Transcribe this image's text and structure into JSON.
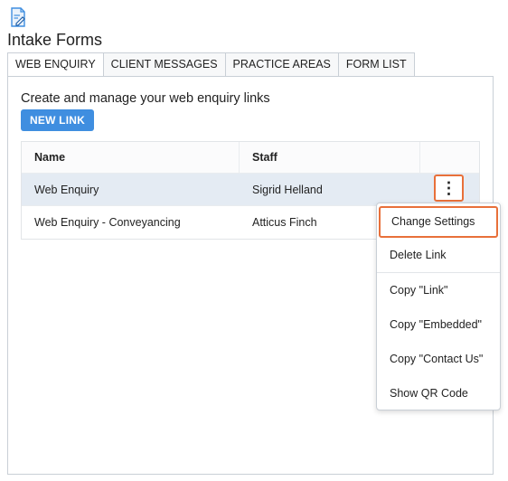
{
  "page": {
    "title": "Intake Forms",
    "icon": "form-edit-icon"
  },
  "tabs": [
    {
      "label": "WEB ENQUIRY",
      "active": true
    },
    {
      "label": "CLIENT MESSAGES",
      "active": false
    },
    {
      "label": "PRACTICE AREAS",
      "active": false
    },
    {
      "label": "FORM LIST",
      "active": false
    }
  ],
  "main": {
    "subtitle": "Create and manage your web enquiry links",
    "new_link_label": "NEW LINK"
  },
  "table": {
    "headers": {
      "name": "Name",
      "staff": "Staff"
    },
    "rows": [
      {
        "name": "Web Enquiry",
        "staff": "Sigrid Helland",
        "highlighted": true
      },
      {
        "name": "Web Enquiry - Conveyancing",
        "staff": "Atticus Finch",
        "highlighted": false
      }
    ]
  },
  "row_actions": {
    "icon": "kebab-menu-icon",
    "glyph": "⋮"
  },
  "context_menu": {
    "items": [
      {
        "label": "Change Settings",
        "focused": true
      },
      {
        "label": "Delete Link"
      },
      {
        "label": "Copy \"Link\""
      },
      {
        "label": "Copy \"Embedded\""
      },
      {
        "label": "Copy \"Contact Us\""
      },
      {
        "label": "Show QR Code"
      }
    ]
  },
  "colors": {
    "accent": "#3f8ee0",
    "focus_outline": "#e8703a",
    "row_highlight": "#e4ebf3",
    "border": "#c9cfd6"
  }
}
